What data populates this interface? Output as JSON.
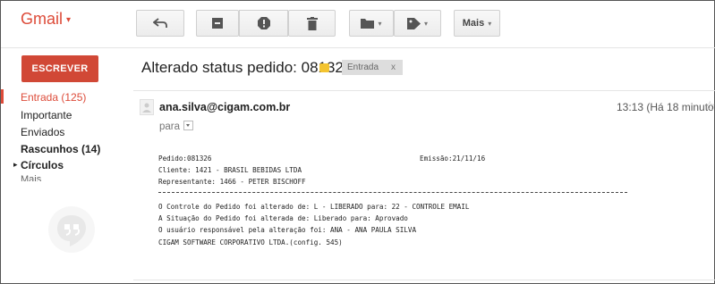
{
  "app": {
    "logo": "Gmail"
  },
  "toolbar": {
    "back_icon": "reply-arrow-icon",
    "archive_icon": "archive-icon",
    "spam_icon": "report-spam-icon",
    "delete_icon": "trash-icon",
    "move_icon": "folder-icon",
    "labels_icon": "label-tag-icon",
    "more_label": "Mais"
  },
  "sidebar": {
    "compose_label": "ESCREVER",
    "items": [
      {
        "label": "Entrada (125)",
        "active": true
      },
      {
        "label": "Importante"
      },
      {
        "label": "Enviados"
      },
      {
        "label": "Rascunhos (14)",
        "bold": true
      },
      {
        "label": "Círculos",
        "bold": true,
        "expandable": true
      },
      {
        "label": "Mais"
      }
    ]
  },
  "message": {
    "subject": "Alterado status pedido: 081326",
    "label_chip": "Entrada",
    "label_remove": "x",
    "sender": "ana.silva@cigam.com.br",
    "time": "13:13 (Há 18 minutos)",
    "to_label": "para",
    "body": {
      "pedido": "Pedido:081326",
      "emissao": "Emissão:21/11/16",
      "cliente": "Cliente: 1421 - BRASIL BEBIDAS LTDA",
      "representante": "Representante: 1466 - PETER BISCHOFF",
      "line1": "O Controle do Pedido foi alterado de: L - LIBERADO para: 22 - CONTROLE EMAIL",
      "line2": "A Situação do Pedido foi alterada de: Liberado para: Aprovado",
      "line3": "O usuário responsável pela alteração foi: ANA - ANA PAULA SILVA",
      "line4": "CIGAM SOFTWARE CORPORATIVO LTDA.(config. 545)"
    }
  },
  "colors": {
    "accent": "#dd4b39",
    "compose": "#d14836",
    "important": "#f4c430"
  }
}
